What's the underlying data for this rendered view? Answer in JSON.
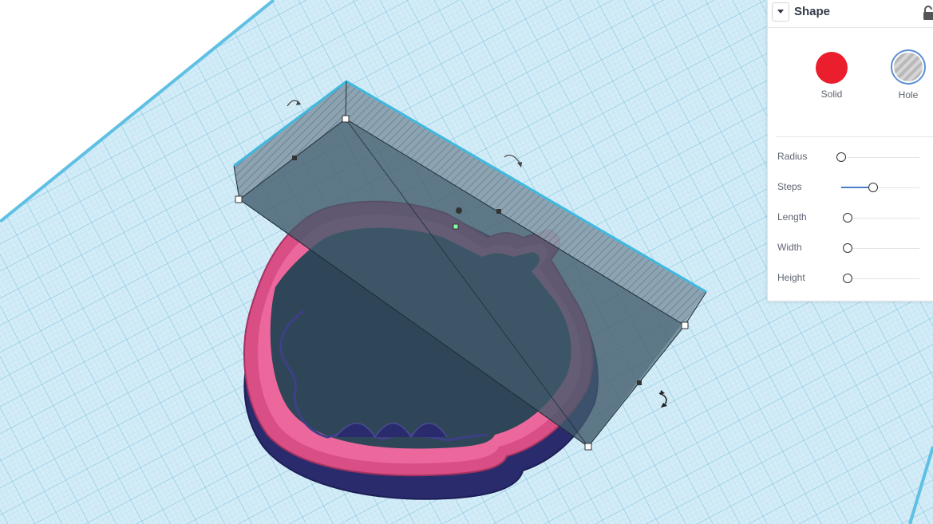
{
  "panel": {
    "title": "Shape",
    "collapse_icon": "caret-down-icon",
    "lock_icon": "unlocked-padlock-icon",
    "types": [
      {
        "label": "Solid",
        "color": "#ea1e2d",
        "selected": false
      },
      {
        "label": "Hole",
        "pattern": "gray-diagonal-stripes",
        "selected": true
      }
    ],
    "params": [
      {
        "label": "Radius",
        "level": 0.0
      },
      {
        "label": "Steps",
        "level": 0.45
      },
      {
        "label": "Length",
        "level": 0.0
      },
      {
        "label": "Width",
        "level": 0.0
      },
      {
        "label": "Height",
        "level": 0.0
      }
    ]
  },
  "colors": {
    "workplane": "#cfeaf6",
    "grid": "#7dc3de",
    "cutter_top": "#ec5c92",
    "cutter_base": "#2e2f72",
    "hole_box": "#5f7585",
    "selection": "#3fb9e0",
    "accent": "#4a7cc7"
  }
}
